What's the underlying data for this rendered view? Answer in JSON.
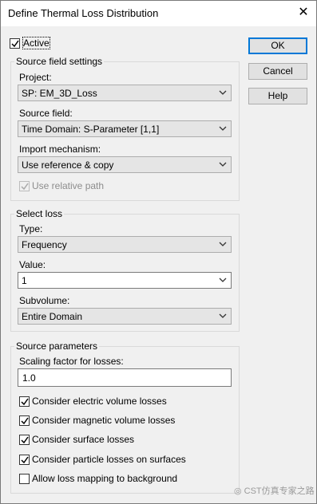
{
  "window": {
    "title": "Define Thermal Loss Distribution"
  },
  "active": {
    "label": "Active",
    "checked": true
  },
  "buttons": {
    "ok": "OK",
    "cancel": "Cancel",
    "help": "Help"
  },
  "source_field_settings": {
    "title": "Source field settings",
    "project_label": "Project:",
    "project_value": "SP: EM_3D_Loss",
    "source_field_label": "Source field:",
    "source_field_value": "Time Domain: S-Parameter [1,1]",
    "import_label": "Import mechanism:",
    "import_value": "Use reference & copy",
    "relative_path_label": "Use relative path",
    "relative_path_checked": true
  },
  "select_loss": {
    "title": "Select loss",
    "type_label": "Type:",
    "type_value": "Frequency",
    "value_label": "Value:",
    "value_value": "1",
    "subvolume_label": "Subvolume:",
    "subvolume_value": "Entire Domain"
  },
  "source_parameters": {
    "title": "Source parameters",
    "scaling_label": "Scaling factor for losses:",
    "scaling_value": "1.0",
    "options": [
      {
        "label": "Consider electric volume losses",
        "checked": true
      },
      {
        "label": "Consider magnetic volume losses",
        "checked": true
      },
      {
        "label": "Consider surface losses",
        "checked": true
      },
      {
        "label": "Consider particle losses on surfaces",
        "checked": true
      },
      {
        "label": "Allow loss mapping to background",
        "checked": false
      }
    ]
  },
  "watermark": "CST仿真专家之路"
}
